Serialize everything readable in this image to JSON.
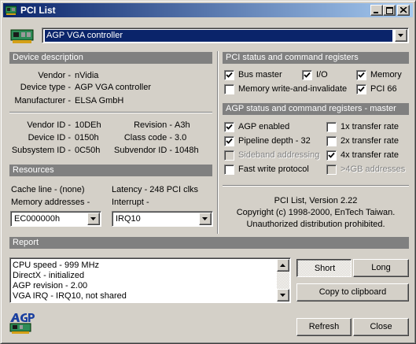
{
  "window": {
    "title": "PCI List"
  },
  "device_select": {
    "value": "AGP VGA controller"
  },
  "device_description": {
    "header": "Device description",
    "vendor_label": "Vendor -",
    "vendor": "nVidia",
    "type_label": "Device type -",
    "type": "AGP VGA controller",
    "manufacturer_label": "Manufacturer -",
    "manufacturer": "ELSA GmbH",
    "vendor_id_label": "Vendor ID -",
    "vendor_id": "10DEh",
    "device_id_label": "Device ID -",
    "device_id": "0150h",
    "subsystem_id_label": "Subsystem ID -",
    "subsystem_id": "0C50h",
    "revision_label": "Revision -",
    "revision": "A3h",
    "class_code_label": "Class code -",
    "class_code": "3.0",
    "subvendor_id_label": "Subvendor ID -",
    "subvendor_id": "1048h"
  },
  "resources": {
    "header": "Resources",
    "cache_line": "Cache line - (none)",
    "latency": "Latency - 248 PCI clks",
    "memory_label": "Memory addresses -",
    "memory_value": "EC000000h",
    "interrupt_label": "Interrupt -",
    "interrupt_value": "IRQ10"
  },
  "pci_status": {
    "header": "PCI status and command registers",
    "items": [
      {
        "label": "Bus master",
        "checked": true,
        "enabled": true
      },
      {
        "label": "I/O",
        "checked": true,
        "enabled": true
      },
      {
        "label": "Memory",
        "checked": true,
        "enabled": true
      },
      {
        "label": "Memory write-and-invalidate",
        "checked": false,
        "enabled": true
      },
      {
        "label": "PCI 66",
        "checked": true,
        "enabled": true
      }
    ]
  },
  "agp_status": {
    "header": "AGP status and command registers - master",
    "items": [
      {
        "label": "AGP enabled",
        "checked": true,
        "enabled": true
      },
      {
        "label": "1x transfer rate",
        "checked": false,
        "enabled": true
      },
      {
        "label": "Pipeline depth - 32",
        "checked": true,
        "enabled": true
      },
      {
        "label": "2x transfer rate",
        "checked": false,
        "enabled": true
      },
      {
        "label": "Sideband addressing",
        "checked": false,
        "enabled": false
      },
      {
        "label": "4x transfer rate",
        "checked": true,
        "enabled": true
      },
      {
        "label": "Fast write protocol",
        "checked": false,
        "enabled": true
      },
      {
        "label": ">4GB addresses",
        "checked": false,
        "enabled": false
      }
    ]
  },
  "about": {
    "line1": "PCI List, Version 2.22",
    "line2": "Copyright (c) 1998-2000, EnTech Taiwan.",
    "line3": "Unauthorized distribution prohibited."
  },
  "report": {
    "header": "Report",
    "lines": [
      "CPU speed - 999 MHz",
      "DirectX - initialized",
      "AGP revision - 2.00",
      "VGA IRQ - IRQ10, not shared"
    ]
  },
  "buttons": {
    "short": "Short",
    "long": "Long",
    "copy": "Copy to clipboard",
    "refresh": "Refresh",
    "close": "Close"
  },
  "colors": {
    "titlebar_start": "#0a246a",
    "titlebar_end": "#a6caf0",
    "face": "#d4d0c8",
    "group_header": "#808080"
  },
  "icons": {
    "title": "pci-card-icon",
    "combo": "pci-card-icon",
    "logo": "agp-logo-icon"
  }
}
